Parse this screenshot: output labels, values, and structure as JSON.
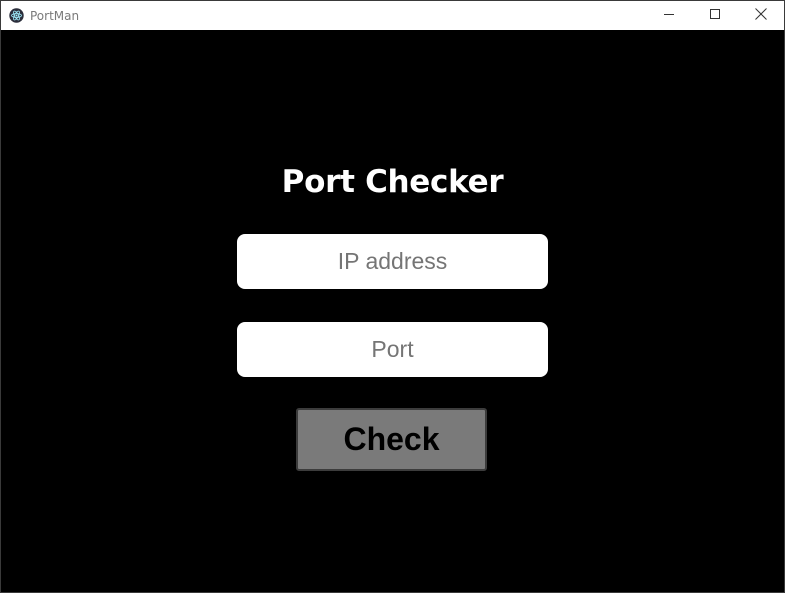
{
  "window": {
    "title": "PortMan",
    "app_icon": "electron-atom-icon",
    "controls": {
      "minimize_icon": "minimize-icon",
      "maximize_icon": "maximize-icon",
      "close_icon": "close-icon"
    }
  },
  "main": {
    "heading": "Port Checker",
    "ip_field": {
      "value": "",
      "placeholder": "IP address"
    },
    "port_field": {
      "value": "",
      "placeholder": "Port"
    },
    "check_button_label": "Check"
  },
  "colors": {
    "background": "#000000",
    "titlebar": "#ffffff",
    "field_background": "#ffffff",
    "button_background": "#7a7a7a",
    "heading_text": "#ffffff"
  }
}
